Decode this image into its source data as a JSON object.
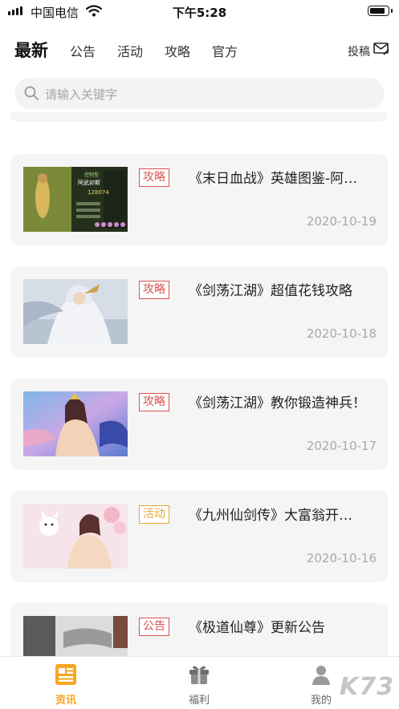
{
  "status_bar": {
    "carrier": "中国电信",
    "time": "下午5:28"
  },
  "tabs": [
    {
      "label": "最新"
    },
    {
      "label": "公告"
    },
    {
      "label": "活动"
    },
    {
      "label": "攻略"
    },
    {
      "label": "官方"
    }
  ],
  "contribute_label": "投稿",
  "search": {
    "placeholder": "请输入关键字"
  },
  "articles": [
    {
      "tag": "攻略",
      "title": "《末日血战》英雄图鉴-阿…",
      "date": "2020-10-19",
      "thumb_text": {
        "a": "控制型",
        "b": "阿武卯斯",
        "c": "128074"
      }
    },
    {
      "tag": "攻略",
      "title": "《剑荡江湖》超值花钱攻略",
      "date": "2020-10-18"
    },
    {
      "tag": "攻略",
      "title": "《剑荡江湖》教你锻造神兵！",
      "date": "2020-10-17"
    },
    {
      "tag": "活动",
      "title": "《九州仙剑传》大富翁开…",
      "date": "2020-10-16"
    },
    {
      "tag": "公告",
      "title": "《极道仙尊》更新公告",
      "date": ""
    }
  ],
  "bottom_nav": [
    {
      "label": "资讯"
    },
    {
      "label": "福利"
    },
    {
      "label": "我的"
    }
  ],
  "watermark": "K73",
  "colors": {
    "accent": "#f5a623",
    "tag_red": "#d9534f",
    "tag_orange": "#e5a73a"
  }
}
